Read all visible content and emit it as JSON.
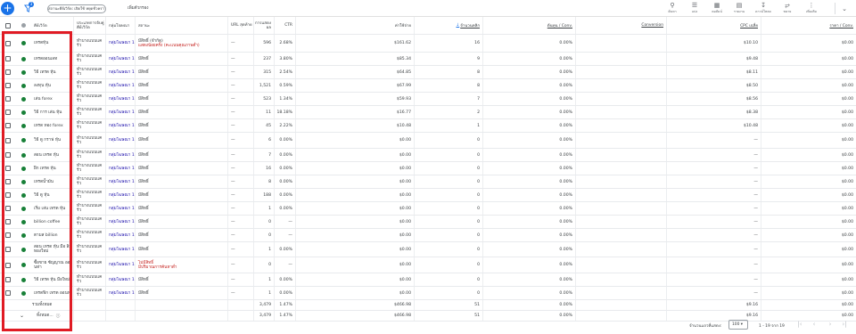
{
  "toolbar": {
    "add_icon": "add-icon",
    "filter_count": "3",
    "chip_label": "สถานะคีย์เวิร์ด: เปิดใช้ หยุดชั่วคราว",
    "add_filter_label": "เพิ่มตัวกรอง",
    "buttons": [
      {
        "name": "search",
        "icon": "search-icon",
        "label": "ค้นหา"
      },
      {
        "name": "segment",
        "icon": "segment-icon",
        "label": "แบ่ง"
      },
      {
        "name": "columns",
        "icon": "columns-icon",
        "label": "คอลัมน์"
      },
      {
        "name": "reports",
        "icon": "reports-icon",
        "label": "รายงาน"
      },
      {
        "name": "download",
        "icon": "download-icon",
        "label": "ดาวน์โหลด"
      },
      {
        "name": "expand",
        "icon": "expand-icon",
        "label": "ขยาย"
      },
      {
        "name": "more",
        "icon": "more-icon",
        "label": "เพิ่มเติม"
      }
    ],
    "collapse_icon": "chevron-down-icon"
  },
  "headers": {
    "keyword": "คีย์เวิร์ด",
    "match_type": "ประเภทการจับคู่คีย์เวิร์ด",
    "ad_group": "กลุ่มโฆษณา",
    "status": "สถานะ",
    "url": "URL สุดท้าย",
    "impr": "การแสดงผล",
    "ctr": "CTR",
    "cost": "ค่าใช้จ่าย",
    "clicks": "จำนวนคลิก",
    "cost_conv": "ต้นทุน / Conv.",
    "conversions": "Conversion",
    "avg_cpc": "CPC เฉลี่ย",
    "price": "ราคา / Conv."
  },
  "rows": [
    {
      "keyword": "เทรดหุ้น",
      "match": "ทำบางแบบแคร้ว",
      "group": "กลุ่มโฆษณา 1",
      "status": "มีสิทธิ์ (จำกัด)",
      "status_note": "แสดงน้อยครั้ง (คะแนนคุณภาพต่ำ)",
      "status_red": false,
      "url": "—",
      "impr": "596",
      "ctr": "2.68%",
      "cost": "$161.62",
      "clicks": "16",
      "cost_conv": "0.00%",
      "conv": "",
      "cpc": "$10.10",
      "price": "$0.00"
    },
    {
      "keyword": "เทรดออนเลท",
      "match": "ทำบางแบบแคร้ว",
      "group": "กลุ่มโฆษณา 1",
      "status": "มีสิทธิ์",
      "status_note": "",
      "status_red": false,
      "url": "—",
      "impr": "237",
      "ctr": "3.80%",
      "cost": "$85.34",
      "clicks": "9",
      "cost_conv": "0.00%",
      "conv": "",
      "cpc": "$9.48",
      "price": "$0.00"
    },
    {
      "keyword": "วิธี เทรด หุ้น",
      "match": "ทำบางแบบแคร้ว",
      "group": "กลุ่มโฆษณา 1",
      "status": "มีสิทธิ์",
      "status_note": "",
      "status_red": false,
      "url": "—",
      "impr": "315",
      "ctr": "2.54%",
      "cost": "$64.85",
      "clicks": "8",
      "cost_conv": "0.00%",
      "conv": "",
      "cpc": "$8.11",
      "price": "$0.00"
    },
    {
      "keyword": "ลงทุน หุ้น",
      "match": "ทำบางแบบแคร้ว",
      "group": "กลุ่มโฆษณา 1",
      "status": "มีสิทธิ์",
      "status_note": "",
      "status_red": false,
      "url": "—",
      "impr": "1,521",
      "ctr": "0.59%",
      "cost": "$67.99",
      "clicks": "8",
      "cost_conv": "0.00%",
      "conv": "",
      "cpc": "$8.50",
      "price": "$0.00"
    },
    {
      "keyword": "เล่น forex",
      "match": "ทำบางแบบแคร้ว",
      "group": "กลุ่มโฆษณา 1",
      "status": "มีสิทธิ์",
      "status_note": "",
      "status_red": false,
      "url": "—",
      "impr": "523",
      "ctr": "1.34%",
      "cost": "$59.93",
      "clicks": "7",
      "cost_conv": "0.00%",
      "conv": "",
      "cpc": "$8.56",
      "price": "$0.00"
    },
    {
      "keyword": "วิธี การ เล่น หุ้น",
      "match": "ทำบางแบบแคร้ว",
      "group": "กลุ่มโฆษณา 1",
      "status": "มีสิทธิ์",
      "status_note": "",
      "status_red": false,
      "url": "—",
      "impr": "11",
      "ctr": "18.18%",
      "cost": "$16.77",
      "clicks": "2",
      "cost_conv": "0.00%",
      "conv": "",
      "cpc": "$8.38",
      "price": "$0.00"
    },
    {
      "keyword": "เทรด ทอง forex",
      "match": "ทำบางแบบแคร้ว",
      "group": "กลุ่มโฆษณา 1",
      "status": "มีสิทธิ์",
      "status_note": "",
      "status_red": false,
      "url": "—",
      "impr": "45",
      "ctr": "2.22%",
      "cost": "$10.48",
      "clicks": "1",
      "cost_conv": "0.00%",
      "conv": "",
      "cpc": "$10.48",
      "price": "$0.00"
    },
    {
      "keyword": "วิธี ดู กราฟ หุ้น",
      "match": "ทำบางแบบแคร้ว",
      "group": "กลุ่มโฆษณา 1",
      "status": "มีสิทธิ์",
      "status_note": "",
      "status_red": false,
      "url": "—",
      "impr": "6",
      "ctr": "0.00%",
      "cost": "$0.00",
      "clicks": "0",
      "cost_conv": "0.00%",
      "conv": "",
      "cpc": "—",
      "price": "$0.00"
    },
    {
      "keyword": "สอน เทรด หุ้น",
      "match": "ทำบางแบบแคร้ว",
      "group": "กลุ่มโฆษณา 1",
      "status": "มีสิทธิ์",
      "status_note": "",
      "status_red": false,
      "url": "—",
      "impr": "7",
      "ctr": "0.00%",
      "cost": "$0.00",
      "clicks": "0",
      "cost_conv": "0.00%",
      "conv": "",
      "cpc": "—",
      "price": "$0.00"
    },
    {
      "keyword": "ฝึก เทรด หุ้น",
      "match": "ทำบางแบบแคร้ว",
      "group": "กลุ่มโฆษณา 1",
      "status": "มีสิทธิ์",
      "status_note": "",
      "status_red": false,
      "url": "—",
      "impr": "16",
      "ctr": "0.00%",
      "cost": "$0.00",
      "clicks": "0",
      "cost_conv": "0.00%",
      "conv": "",
      "cpc": "—",
      "price": "$0.00"
    },
    {
      "keyword": "เทรดน้ำมัน",
      "match": "ทำบางแบบแคร้ว",
      "group": "กลุ่มโฆษณา 1",
      "status": "มีสิทธิ์",
      "status_note": "",
      "status_red": false,
      "url": "—",
      "impr": "8",
      "ctr": "0.00%",
      "cost": "$0.00",
      "clicks": "0",
      "cost_conv": "0.00%",
      "conv": "",
      "cpc": "—",
      "price": "$0.00"
    },
    {
      "keyword": "วิธี ดู หุ้น",
      "match": "ทำบางแบบแคร้ว",
      "group": "กลุ่มโฆษณา 1",
      "status": "มีสิทธิ์",
      "status_note": "",
      "status_red": false,
      "url": "—",
      "impr": "188",
      "ctr": "0.00%",
      "cost": "$0.00",
      "clicks": "0",
      "cost_conv": "0.00%",
      "conv": "",
      "cpc": "—",
      "price": "$0.00"
    },
    {
      "keyword": "เริ่ม เล่น เทรด หุ้น",
      "match": "ทำบางแบบแคร้ว",
      "group": "กลุ่มโฆษณา 1",
      "status": "มีสิทธิ์",
      "status_note": "",
      "status_red": false,
      "url": "—",
      "impr": "1",
      "ctr": "0.00%",
      "cost": "$0.00",
      "clicks": "0",
      "cost_conv": "0.00%",
      "conv": "",
      "cpc": "—",
      "price": "$0.00"
    },
    {
      "keyword": "billion coffee",
      "match": "ทำบางแบบแคร้ว",
      "group": "กลุ่มโฆษณา 1",
      "status": "มีสิทธิ์",
      "status_note": "",
      "status_red": false,
      "url": "—",
      "impr": "0",
      "ctr": "—",
      "cost": "$0.00",
      "clicks": "0",
      "cost_conv": "0.00%",
      "conv": "",
      "cpc": "—",
      "price": "$0.00"
    },
    {
      "keyword": "ตามส billion",
      "match": "ทำบางแบบแคร้ว",
      "group": "กลุ่มโฆษณา 1",
      "status": "มีสิทธิ์",
      "status_note": "",
      "status_red": false,
      "url": "—",
      "impr": "0",
      "ctr": "—",
      "cost": "$0.00",
      "clicks": "0",
      "cost_conv": "0.00%",
      "conv": "",
      "cpc": "—",
      "price": "$0.00"
    },
    {
      "keyword": "สอน เทรด หุ้น มือ ลิม ทองใหม่",
      "match": "ทำบางแบบแคร้ว",
      "group": "กลุ่มโฆษณา 1",
      "status": "มีสิทธิ์",
      "status_note": "",
      "status_red": false,
      "url": "—",
      "impr": "1",
      "ctr": "0.00%",
      "cost": "$0.00",
      "clicks": "0",
      "cost_conv": "0.00%",
      "conv": "",
      "cpc": "—",
      "price": "$0.00"
    },
    {
      "keyword": "ซื้อขาย ซัญญาณ ออนท่า",
      "match": "ทำบางแบบแคร้ว",
      "group": "กลุ่มโฆษณา 1",
      "status": "ไม่มีสิทธิ์",
      "status_note": "มีปริมาณการค้นหาต่ำ",
      "status_red": true,
      "url": "—",
      "impr": "0",
      "ctr": "—",
      "cost": "$0.00",
      "clicks": "0",
      "cost_conv": "0.00%",
      "conv": "",
      "cpc": "—",
      "price": "$0.00"
    },
    {
      "keyword": "วิธี เทรด หุ้น มือใหม่",
      "match": "ทำบางแบบแคร้ว",
      "group": "กลุ่มโฆษณา 1",
      "status": "มีสิทธิ์",
      "status_note": "",
      "status_red": false,
      "url": "—",
      "impr": "1",
      "ctr": "0.00%",
      "cost": "$0.00",
      "clicks": "0",
      "cost_conv": "0.00%",
      "conv": "",
      "cpc": "—",
      "price": "$0.00"
    },
    {
      "keyword": "เทรดฟิก เทรด ออนท่า",
      "match": "ทำบางแบบแคร้ว",
      "group": "กลุ่มโฆษณา 1",
      "status": "มีสิทธิ์",
      "status_note": "",
      "status_red": false,
      "url": "—",
      "impr": "1",
      "ctr": "0.00%",
      "cost": "$0.00",
      "clicks": "0",
      "cost_conv": "0.00%",
      "conv": "",
      "cpc": "—",
      "price": "$0.00"
    }
  ],
  "totals": [
    {
      "label": "รวมทั้งหมด",
      "impr": "3,479",
      "ctr": "1.47%",
      "cost": "$466.98",
      "clicks": "51",
      "cost_conv": "0.00%",
      "cpc": "$9.16",
      "price": "$0.00"
    },
    {
      "label": "ทั้งหมด...",
      "impr": "3,479",
      "ctr": "1.47%",
      "cost": "$466.98",
      "clicks": "51",
      "cost_conv": "0.00%",
      "cpc": "$9.16",
      "price": "$0.00"
    }
  ],
  "footer": {
    "rows_label": "จำนวนแถวที่แสดง:",
    "rows_value": "100",
    "range": "1 - 19 จาก 19"
  }
}
